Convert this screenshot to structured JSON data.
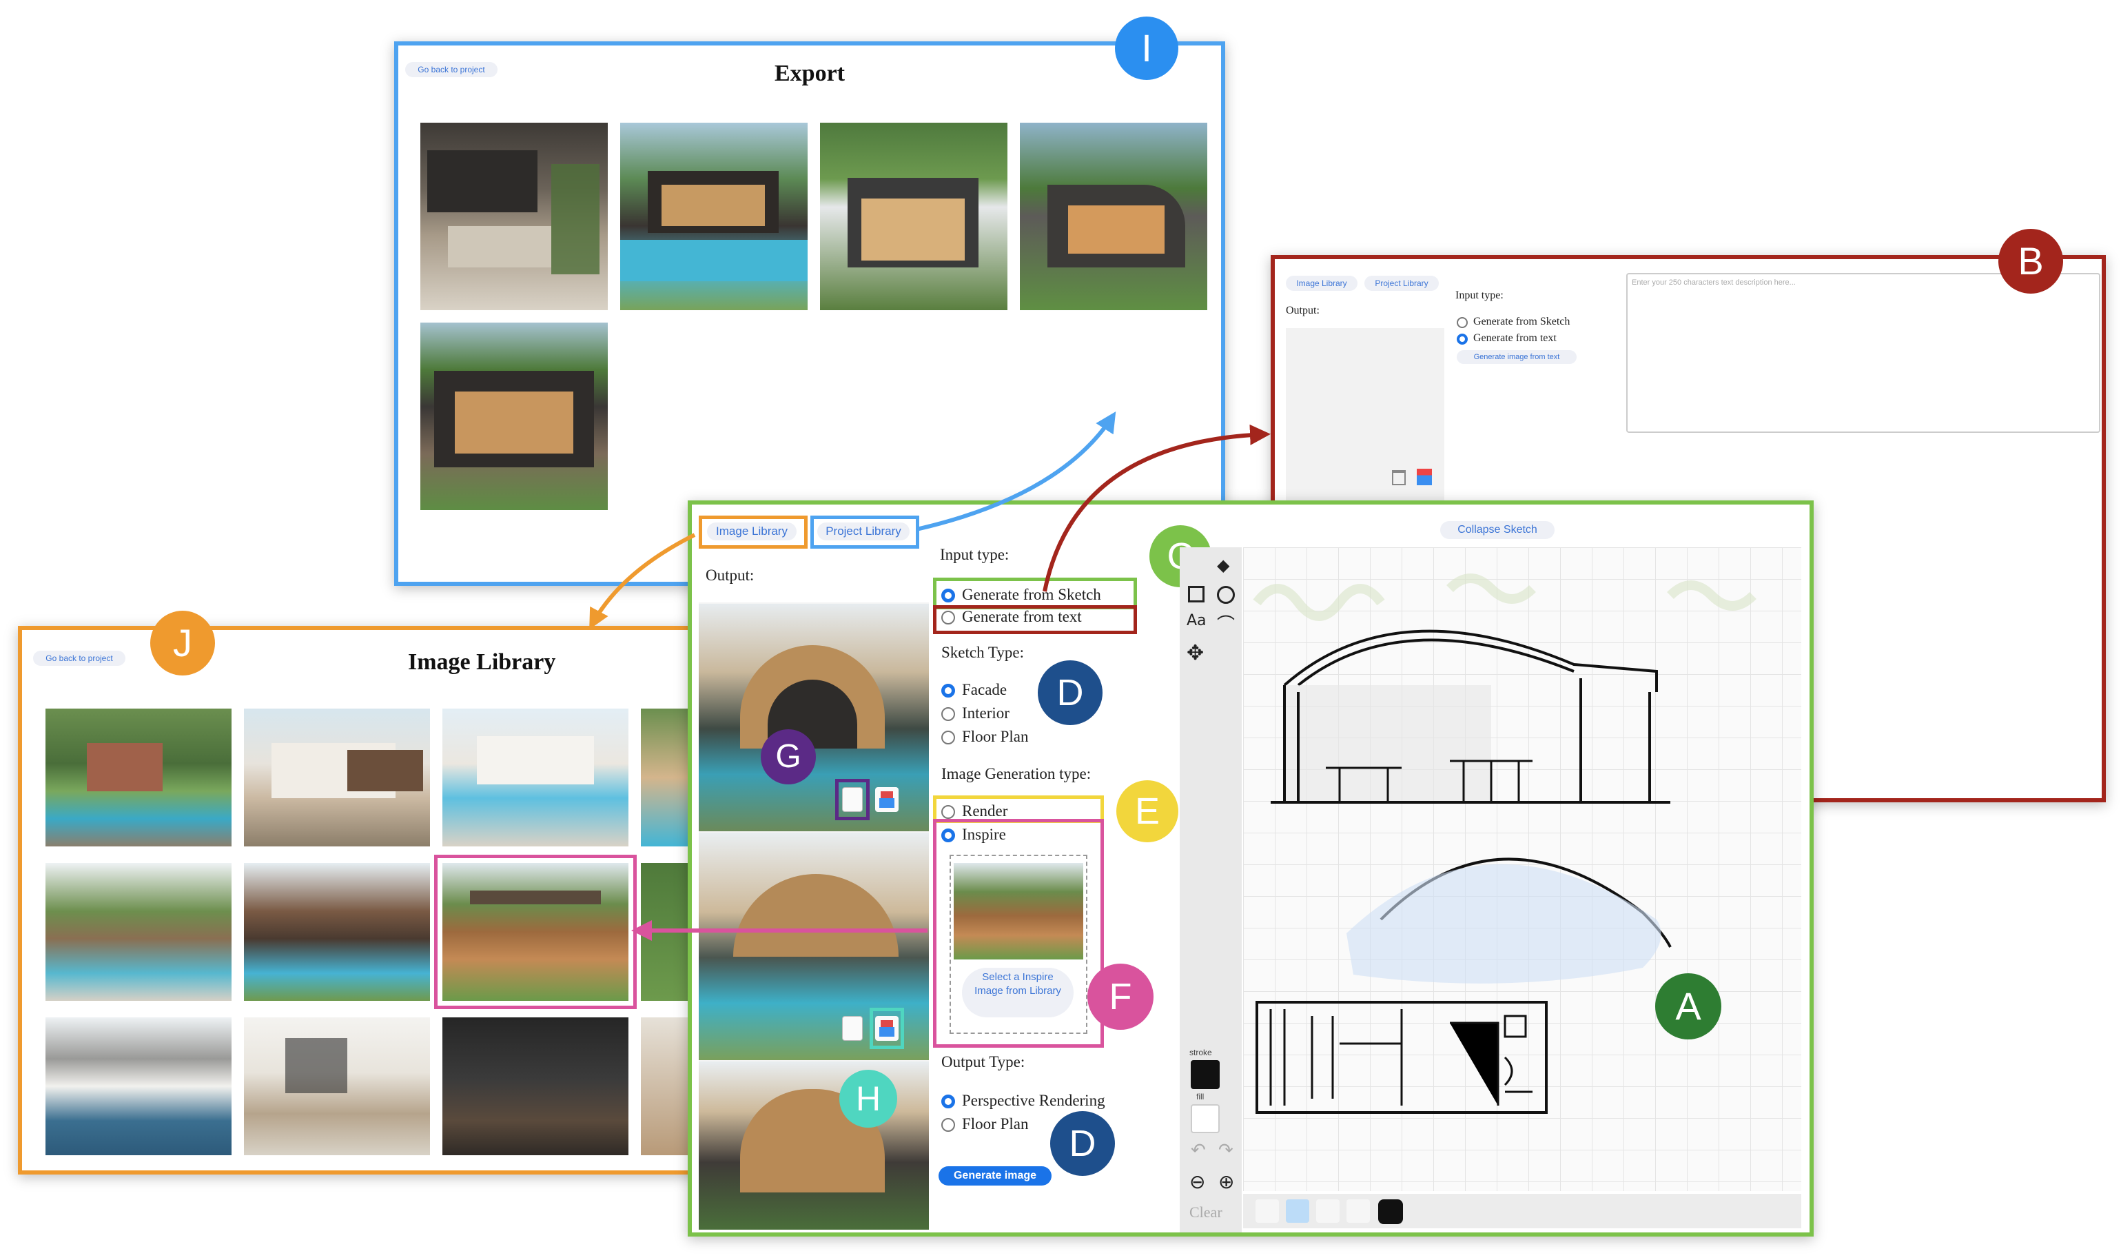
{
  "export": {
    "back_label": "Go back to project",
    "title": "Export",
    "badge": "I"
  },
  "text_panel": {
    "badge": "B",
    "tab_image_library": "Image Library",
    "tab_project_library": "Project Library",
    "output_label": "Output:",
    "input_type_label": "Input type:",
    "opt_sketch": "Generate from Sketch",
    "opt_text": "Generate from text",
    "generate_button": "Generate image from text",
    "textarea_placeholder": "Enter your 250 characters text description here..."
  },
  "image_library": {
    "badge": "J",
    "back_label": "Go back to project",
    "title": "Image Library"
  },
  "main": {
    "tab_image_library": "Image Library",
    "tab_project_library": "Project Library",
    "output_label": "Output:",
    "input_type_label": "Input type:",
    "opt_sketch": "Generate from Sketch",
    "opt_text": "Generate from text",
    "sketch_type_label": "Sketch Type:",
    "sketch_types": [
      "Facade",
      "Interior",
      "Floor Plan"
    ],
    "gen_type_label": "Image Generation type:",
    "opt_render": "Render",
    "opt_inspire": "Inspire",
    "select_inspire": "Select a Inspire Image from Library",
    "output_type_label": "Output Type:",
    "output_types": [
      "Perspective Rendering",
      "Floor Plan"
    ],
    "generate_button": "Generate image",
    "collapse_sketch": "Collapse Sketch",
    "tool_text": "Aa",
    "stroke_label": "stroke",
    "fill_label": "fill",
    "clear_label": "Clear"
  },
  "badges": {
    "A": "A",
    "C": "C",
    "D1": "D",
    "D2": "D",
    "E": "E",
    "F": "F",
    "G": "G",
    "H": "H"
  },
  "colors": {
    "blue_frame": "#4ea3f0",
    "red_frame": "#a3251c",
    "orange_frame": "#ef9a2e",
    "green_frame": "#7cc24a",
    "pink": "#d9539d",
    "yellow": "#f2d63c",
    "purple": "#5b2a86",
    "teal": "#4fd6c0",
    "dark_blue_badge": "#1e4f8c",
    "green_badge": "#2e7d32"
  }
}
